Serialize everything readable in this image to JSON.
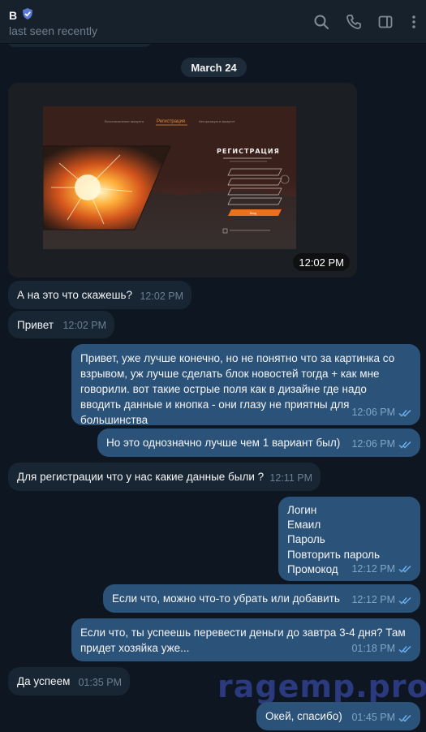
{
  "header": {
    "name": "B",
    "status": "last seen recently"
  },
  "date_separator": "March 24",
  "photo": {
    "time": "12:02 PM",
    "tabs": [
      "",
      "Регистрация",
      ""
    ],
    "heading": "РЕГИСТРАЦИЯ",
    "submit": "Вход"
  },
  "messages": [
    {
      "dir": "in",
      "text": "А на это что скажешь?",
      "time": "12:02 PM"
    },
    {
      "dir": "in",
      "text": "Привет",
      "time": "12:02 PM"
    },
    {
      "dir": "out",
      "text": "Привет, уже лучше конечно, но не понятно что за картинка со взрывом, уж лучше сделать блок новостей тогда + как мне говорили. вот такие острые поля как в дизайне где надо вводить данные и кнопка - они глазу не приятны для большинства",
      "time": "12:06 PM"
    },
    {
      "dir": "out",
      "text": "Но это однозначно лучше чем 1 вариант был)",
      "time": "12:06 PM"
    },
    {
      "dir": "in",
      "text": "Для регистрации что у нас какие данные были ?",
      "time": "12:11 PM"
    },
    {
      "dir": "out",
      "lines": [
        "Логин",
        "Емаил",
        "Пароль",
        "Повторить пароль",
        "Промокод"
      ],
      "time": "12:12 PM"
    },
    {
      "dir": "out",
      "text": "Если что, можно что-то убрать или добавить",
      "time": "12:12 PM"
    },
    {
      "dir": "out",
      "text": "Если что, ты успеешь перевести деньги до завтра 3-4 дня? Там придет хозяйка уже...",
      "time": "01:18 PM"
    },
    {
      "dir": "in",
      "text": "Да успеем",
      "time": "01:35 PM"
    },
    {
      "dir": "out",
      "text": "Окей, спасибо)",
      "time": "01:45 PM"
    }
  ],
  "watermark": "ragemp.pro",
  "colors": {
    "background": "#0e1621",
    "header": "#17212b",
    "incoming": "#182533",
    "outgoing": "#2b5278",
    "accent": "#6ab2f2"
  },
  "icons": [
    "verified-badge-icon",
    "search-icon",
    "phone-icon",
    "sidebar-toggle-icon",
    "more-vertical-icon"
  ]
}
